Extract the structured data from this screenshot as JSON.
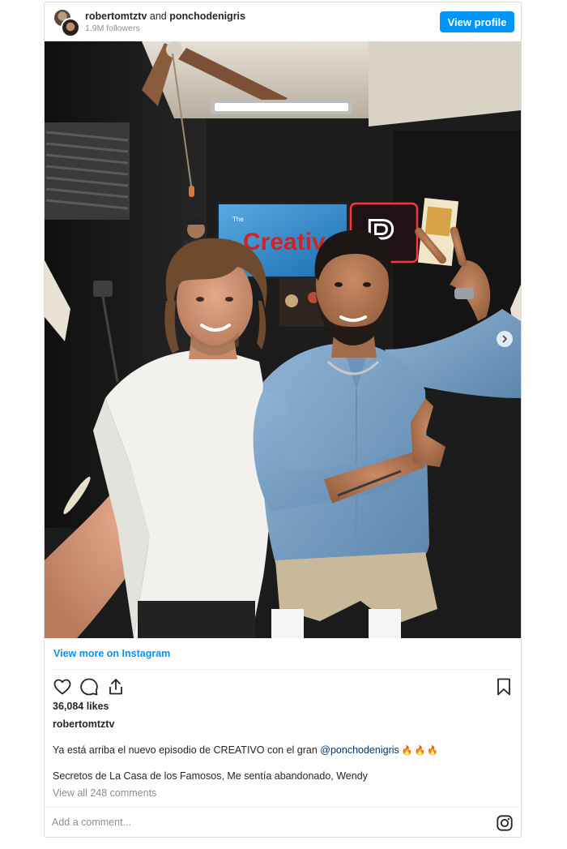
{
  "header": {
    "user1": "robertomtztv",
    "connector": "and",
    "user2": "ponchodenigris",
    "followers": "1.9M followers",
    "view_profile": "View profile"
  },
  "photo": {
    "sign_text": "Creativo",
    "sign_prefix": "The",
    "neon_letter": "P",
    "icons": {
      "next": "chevron-right-icon"
    }
  },
  "links": {
    "view_more": "View more on Instagram"
  },
  "actions": {
    "icons": [
      "heart-icon",
      "comment-icon",
      "share-icon",
      "bookmark-icon"
    ]
  },
  "post": {
    "likes": "36,084 likes",
    "author": "robertomtztv",
    "caption_text": "Ya está arriba el nuevo episodio de CREATIVO con el gran ",
    "caption_mention": "@ponchodenigris",
    "caption_emoji": "🔥🔥🔥",
    "caption_line2": "Secretos de La Casa de los Famosos, Me sentía abandonado, Wendy",
    "view_comments": "View all 248 comments"
  },
  "comment_box": {
    "placeholder": "Add a comment..."
  },
  "colors": {
    "accent": "#0095f6",
    "mention": "#00376b",
    "muted": "#8e8e8e"
  }
}
